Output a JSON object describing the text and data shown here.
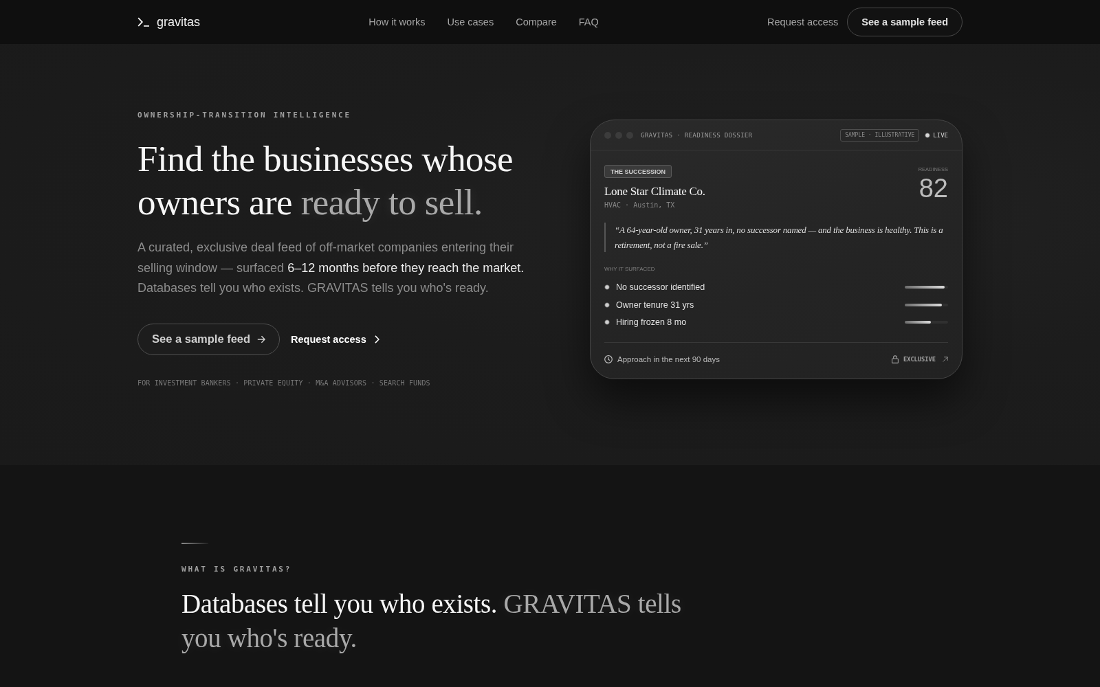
{
  "nav": {
    "logo": "gravitas",
    "links": [
      "How it works",
      "Use cases",
      "Compare",
      "FAQ"
    ],
    "request_link": "Request access",
    "cta_button": "See a sample feed"
  },
  "hero": {
    "eyebrow": "OWNERSHIP-TRANSITION INTELLIGENCE",
    "title": [
      {
        "text": "Find the businesses whose owners are",
        "highlight": false
      },
      {
        "text": "ready to sell.",
        "highlight": true
      }
    ],
    "lead": [
      {
        "text": "A curated, exclusive deal feed of off-market companies entering their selling window — surfaced",
        "highlight": false
      },
      {
        "text": "6–12 months before they reach the market.",
        "highlight": true
      },
      {
        "text": "Databases tell you who exists. GRAVITAS tells you who's ready.",
        "highlight": false
      }
    ],
    "primary_button": "See a sample feed",
    "secondary_link": "Request access",
    "audiences": "FOR INVESTMENT BANKERS · PRIVATE EQUITY · M&A ADVISORS · SEARCH FUNDS"
  },
  "dossier": {
    "header_title": "GRAVITAS · READINESS DOSSIER",
    "badge": "SAMPLE · ILLUSTRATIVE",
    "status": "LIVE",
    "tag": "THE SUCCESSION",
    "company": "Lone Star Climate Co.",
    "meta": "HVAC · Austin, TX",
    "score_label": "READINESS",
    "score": "82",
    "quote": "“A 64-year-old owner, 31 years in, no successor named — and the business is healthy. This is a retirement, not a fire sale.”",
    "signals_label": "WHY IT SURFACED",
    "signals": [
      {
        "label": "No successor identified",
        "level": 0.92
      },
      {
        "label": "Owner tenure 31 yrs",
        "level": 0.85
      },
      {
        "label": "Hiring frozen 8 mo",
        "level": 0.61
      }
    ],
    "footer_note": "Approach in the next 90 days",
    "footer_link": "EXCLUSIVE"
  },
  "about": {
    "eyebrow": "WHAT IS GRAVITAS?",
    "title": [
      {
        "text": "Databases tell you who exists.",
        "highlight": false
      },
      {
        "text": "GRAVITAS tells you who's ready.",
        "highlight": true
      }
    ]
  }
}
